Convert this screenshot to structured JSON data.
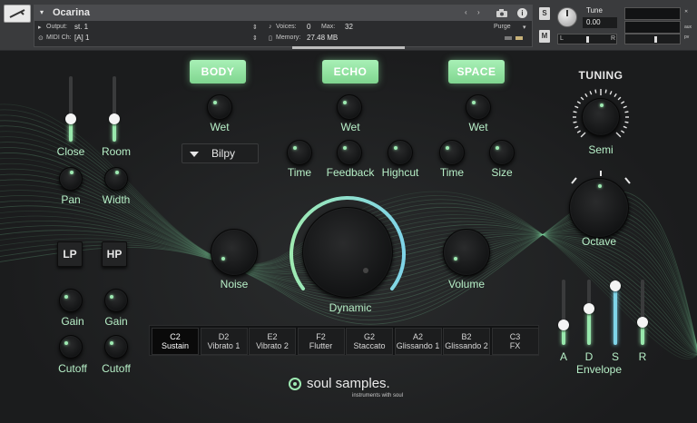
{
  "header": {
    "instrument_name": "Ocarina",
    "output_label": "Output:",
    "output_value": "st. 1",
    "midi_label": "MIDI Ch:",
    "midi_value": "[A] 1",
    "voices_label": "Voices:",
    "voices_value": "0",
    "max_label": "Max:",
    "max_value": "32",
    "memory_label": "Memory:",
    "memory_value": "27.48 MB",
    "purge_label": "Purge",
    "info_glyph": "i",
    "solo_label": "S",
    "mute_label": "M",
    "tune_label": "Tune",
    "tune_value": "0.00",
    "aux_label": "aux",
    "pv_label": "pv",
    "lr_left": "L",
    "lr_right": "R"
  },
  "left": {
    "close_label": "Close",
    "room_label": "Room",
    "close_level": 0.35,
    "room_level": 0.35,
    "pan_label": "Pan",
    "width_label": "Width",
    "lp_label": "LP",
    "hp_label": "HP",
    "gain1_label": "Gain",
    "gain2_label": "Gain",
    "cutoff1_label": "Cutoff",
    "cutoff2_label": "Cutoff"
  },
  "body": {
    "button": "BODY",
    "wet_label": "Wet",
    "ir_select": "Bilpy"
  },
  "echo": {
    "button": "ECHO",
    "wet_label": "Wet",
    "time_label": "Time",
    "feedback_label": "Feedback",
    "highcut_label": "Highcut"
  },
  "space": {
    "button": "SPACE",
    "wet_label": "Wet",
    "time_label": "Time",
    "size_label": "Size"
  },
  "center": {
    "noise_label": "Noise",
    "dynamic_label": "Dynamic",
    "volume_label": "Volume"
  },
  "tuning": {
    "title": "TUNING",
    "semi_label": "Semi",
    "octave_label": "Octave"
  },
  "articulations": [
    {
      "note": "C2",
      "name": "Sustain"
    },
    {
      "note": "D2",
      "name": "Vibrato 1"
    },
    {
      "note": "E2",
      "name": "Vibrato 2"
    },
    {
      "note": "F2",
      "name": "Flutter"
    },
    {
      "note": "G2",
      "name": "Staccato"
    },
    {
      "note": "A2",
      "name": "Glissando 1"
    },
    {
      "note": "B2",
      "name": "Glissando 2"
    },
    {
      "note": "C3",
      "name": "FX"
    }
  ],
  "envelope": {
    "title": "Envelope",
    "a_label": "A",
    "d_label": "D",
    "s_label": "S",
    "r_label": "R",
    "a_level": 0.3,
    "d_level": 0.55,
    "s_level": 0.9,
    "r_level": 0.35
  },
  "brand": {
    "name": "soul samples.",
    "tagline": "instruments with soul"
  },
  "colors": {
    "accent": "#9eeab2",
    "panel_bg": "#1e1f21",
    "header_bg": "#3a3b3d",
    "dynamic_arc_end": "#7fd4e8"
  }
}
